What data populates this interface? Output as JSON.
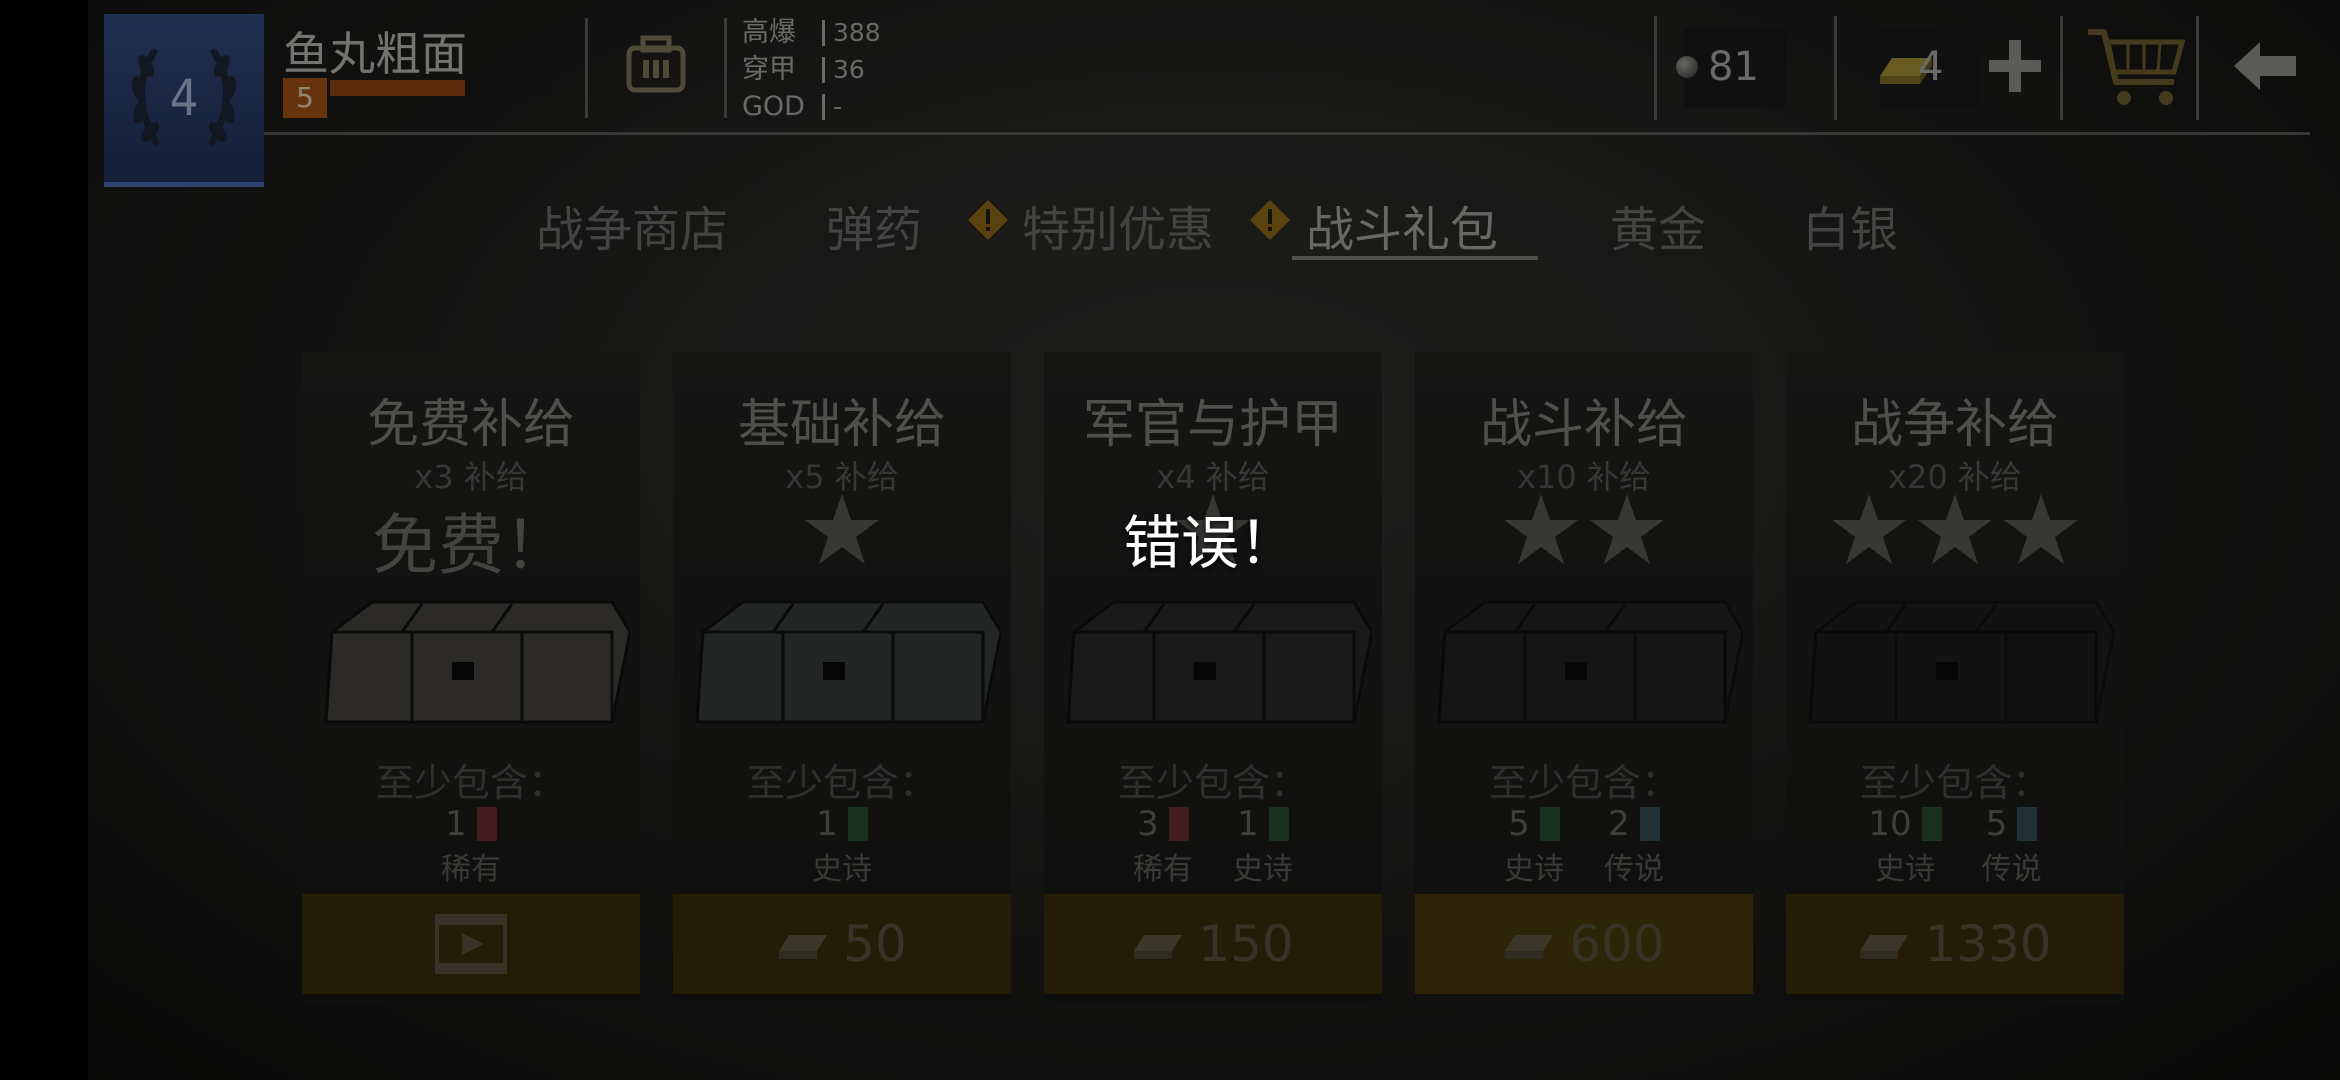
{
  "player": {
    "rank": "4",
    "name": "鱼丸粗面",
    "level": "5",
    "xp_fraction": 0.61
  },
  "stats": [
    {
      "label": "高爆",
      "value": "388"
    },
    {
      "label": "穿甲",
      "value": "36"
    },
    {
      "label": "GOD",
      "value": "-"
    }
  ],
  "resources": {
    "silver": "81",
    "gold": "4"
  },
  "icons": {
    "ammo": "ammo-crate-icon",
    "silver": "silver-ball-icon",
    "gold": "gold-bar-icon",
    "plus": "plus-icon",
    "cart": "shopping-cart-icon",
    "back": "back-arrow-icon"
  },
  "tabs": [
    {
      "label": "战争商店",
      "active": false,
      "alert": false
    },
    {
      "label": "弹药",
      "active": false,
      "alert": false
    },
    {
      "label": "特别优惠",
      "active": false,
      "alert": true
    },
    {
      "label": "战斗礼包",
      "active": true,
      "alert": true
    },
    {
      "label": "黄金",
      "active": false,
      "alert": false
    },
    {
      "label": "白银",
      "active": false,
      "alert": false
    }
  ],
  "contains_label": "至少包含：",
  "colors": {
    "rare": "#5a2727",
    "epic": "#22402a",
    "legendary": "#2a4048",
    "button": "#3a2e0a",
    "rank_badge": "#22355c"
  },
  "cards": [
    {
      "title": "免费补给",
      "subtitle": "x3 补给",
      "free_label": "免费！",
      "stars": 0,
      "rewards": [
        {
          "count": "1",
          "rarity": "稀有"
        }
      ],
      "button": {
        "type": "video",
        "price": ""
      }
    },
    {
      "title": "基础补给",
      "subtitle": "x5 补给",
      "free_label": "",
      "stars": 1,
      "rewards": [
        {
          "count": "1",
          "rarity": "史诗"
        }
      ],
      "button": {
        "type": "gold",
        "price": "50"
      }
    },
    {
      "title": "军官与护甲",
      "subtitle": "x4 补给",
      "free_label": "",
      "stars": 1,
      "rewards": [
        {
          "count": "3",
          "rarity": "稀有"
        },
        {
          "count": "1",
          "rarity": "史诗"
        }
      ],
      "button": {
        "type": "gold",
        "price": "150"
      }
    },
    {
      "title": "战斗补给",
      "subtitle": "x10 补给",
      "free_label": "",
      "stars": 2,
      "rewards": [
        {
          "count": "5",
          "rarity": "史诗"
        },
        {
          "count": "2",
          "rarity": "传说"
        }
      ],
      "button": {
        "type": "gold",
        "price": "600"
      }
    },
    {
      "title": "战争补给",
      "subtitle": "x20 补给",
      "free_label": "",
      "stars": 3,
      "rewards": [
        {
          "count": "10",
          "rarity": "史诗"
        },
        {
          "count": "5",
          "rarity": "传说"
        }
      ],
      "button": {
        "type": "gold",
        "price": "1330"
      }
    }
  ],
  "error": {
    "message": "错误！"
  }
}
